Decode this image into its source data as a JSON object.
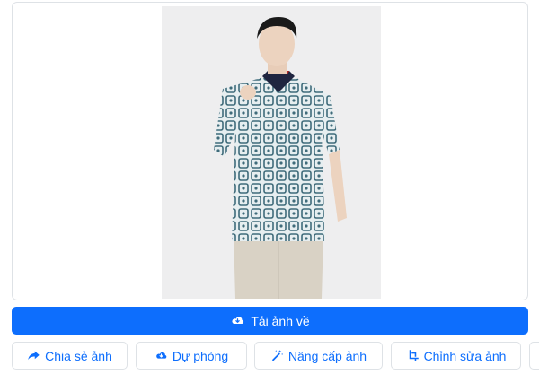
{
  "image": {
    "alt": ""
  },
  "download_label": "Tải ảnh về",
  "actions": [
    {
      "label": "Chia sẻ ảnh",
      "icon": "share-icon"
    },
    {
      "label": "Dự phòng",
      "icon": "cloud-download-icon"
    },
    {
      "label": "Nâng cấp ảnh",
      "icon": "magic-wand-icon"
    },
    {
      "label": "Chỉnh sửa ảnh",
      "icon": "crop-icon"
    }
  ],
  "colors": {
    "primary": "#0d6efd",
    "border": "#dee2e6"
  }
}
